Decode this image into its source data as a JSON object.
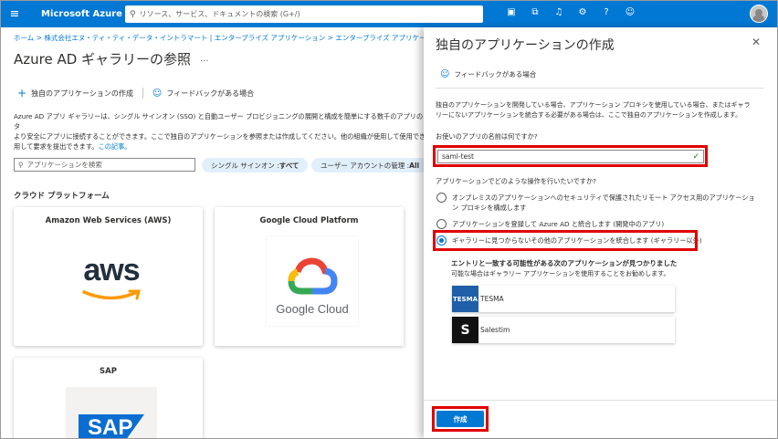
{
  "topbar": {
    "brand": "Microsoft Azure",
    "search_placeholder": "リソース、サービス、ドキュメントの検索 (G+/)",
    "icons": [
      "cloud-shell-icon",
      "directory-filter-icon",
      "notifications-icon",
      "settings-icon",
      "help-icon",
      "feedback-icon"
    ]
  },
  "background_page": {
    "breadcrumb": "ホーム > 株式会社エヌ・ティ・ティ・データ・イントラマート | エンタープライズ アプリケーション > エンタープライズ アプリケーション |",
    "title": "Azure AD ギャラリーの参照",
    "more": "···",
    "cmd_new_app": "独自のアプリケーションの作成",
    "cmd_feedback": "フィードバックがある場合",
    "description": "Azure AD アプリ ギャラリーは、シングル サインオン (SSO) と自動ユーザー プロビジョニングの展開と構成を簡単にする数千のアプリのカタ",
    "description2": "より安全にアプリに接続することができます。ここで独自のアプリケーションを参照または作成してください。他の組織が使用して使用でき",
    "description3": "用して要求を提出できます。",
    "description_link": "この記事。",
    "app_search_placeholder": "アプリケーションを検索",
    "filter_sso_label": "シングル サインオン : ",
    "filter_sso_value": "すべて",
    "filter_user_label": "ユーザー アカウントの管理 : ",
    "filter_user_value": "All",
    "section_heading": "クラウド プラットフォーム",
    "tiles": [
      {
        "name": "Amazon Web Services (AWS)",
        "logo_text": "aws"
      },
      {
        "name": "Google Cloud Platform",
        "logo_text": "Google Cloud"
      },
      {
        "name": "SAP",
        "logo_text": "SAP"
      }
    ]
  },
  "panel": {
    "title": "独自のアプリケーションの作成",
    "close": "✕",
    "feedback": "フィードバックがある場合",
    "description": "独自のアプリケーションを開発している場合、アプリケーション プロキシを使用している場合、またはギャラリーにないアプリケーションを統合する必要がある場合は、ここで独自のアプリケーションを作成します。",
    "name_label": "お使いのアプリの名前は何ですか?",
    "name_value": "saml-test",
    "question": "アプリケーションでどのような操作を行いたいですか?",
    "options": [
      {
        "label": "オンプレミスのアプリケーションへのセキュリティで保護されたリモート アクセス用のアプリケーション プロキシを構成します",
        "selected": false
      },
      {
        "label": "アプリケーションを登録して Azure AD と統合します (開発中のアプリ)",
        "selected": false
      },
      {
        "label": "ギャラリーに見つからないその他のアプリケーションを統合します (ギャラリー以外)",
        "selected": true
      }
    ],
    "matches_title": "エントリと一致する可能性がある次のアプリケーションが見つかりました",
    "matches_subtitle": "可能な場合はギャラリー アプリケーションを使用することをお勧めします。",
    "matches": [
      {
        "name": "TESMA",
        "logo_text": "TESMA",
        "logo_color": "#1f5fa8"
      },
      {
        "name": "Salestim",
        "logo_text": "S",
        "logo_color": "#111111"
      }
    ],
    "create_button": "作成"
  },
  "colors": {
    "azure_blue": "#0078d4",
    "highlight_red": "#e00000"
  }
}
